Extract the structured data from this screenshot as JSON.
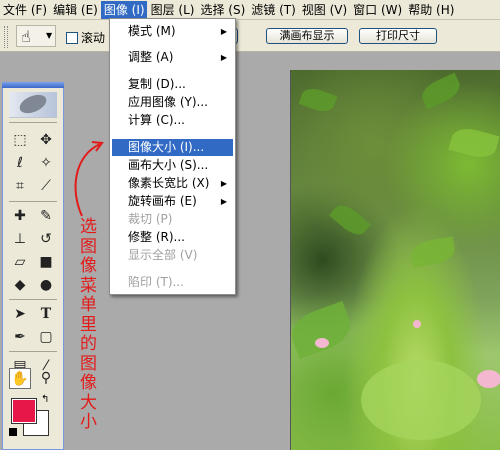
{
  "menubar": {
    "items": [
      {
        "label": "文件 (F)"
      },
      {
        "label": "编辑 (E)"
      },
      {
        "label": "图像 (I)"
      },
      {
        "label": "图层 (L)"
      },
      {
        "label": "选择 (S)"
      },
      {
        "label": "滤镜 (T)"
      },
      {
        "label": "视图 (V)"
      },
      {
        "label": "窗口 (W)"
      },
      {
        "label": "帮助 (H)"
      }
    ]
  },
  "options": {
    "scroll_all_label": "滚动",
    "fit_screen_label": "满画布显示",
    "print_size_label": "打印尺寸"
  },
  "image_menu": {
    "items": [
      {
        "label": "模式 (M)"
      },
      {
        "label": "调整 (A)"
      },
      {
        "label": "复制 (D)..."
      },
      {
        "label": "应用图像 (Y)..."
      },
      {
        "label": "计算 (C)..."
      },
      {
        "label": "图像大小 (I)..."
      },
      {
        "label": "画布大小 (S)..."
      },
      {
        "label": "像素长宽比 (X)"
      },
      {
        "label": "旋转画布 (E)"
      },
      {
        "label": "裁切 (P)"
      },
      {
        "label": "修整 (R)..."
      },
      {
        "label": "显示全部 (V)"
      },
      {
        "label": "陷印 (T)..."
      }
    ]
  },
  "annotation": {
    "text": "选图像菜单里的图像大小"
  },
  "colors": {
    "foreground": "#e8174a",
    "background": "#ffffff",
    "highlight": "#316ac5",
    "annotation": "#e41b1b"
  }
}
